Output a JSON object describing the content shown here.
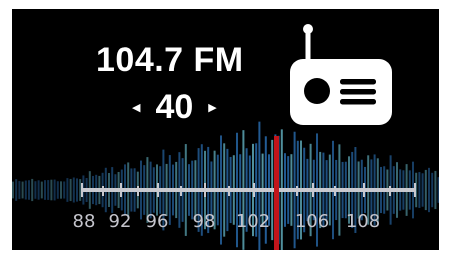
{
  "station": {
    "frequency": "104.7 FM",
    "preset_number": "40",
    "prev_label": "◀",
    "next_label": "▶"
  },
  "icons": {
    "radio": "radio-icon",
    "prev": "triangle-left-icon",
    "next": "triangle-right-icon"
  },
  "tuner": {
    "scale_labels": [
      "88",
      "92",
      "96",
      "98",
      "102",
      "106",
      "108"
    ],
    "needle_color": "#c2151b"
  },
  "colors": {
    "background": "#000000",
    "text": "#ffffff",
    "spectrum_blue": "#2f7cc8",
    "spectrum_cyan": "#6ec6d8",
    "scale": "#c9c9cf"
  }
}
